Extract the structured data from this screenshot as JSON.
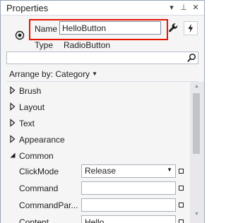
{
  "window": {
    "title": "Properties"
  },
  "titlebar": {
    "dropdown_glyph": "▾",
    "pin_glyph": "⊥",
    "close_glyph": "✕"
  },
  "selection": {
    "name_label": "Name",
    "name_value": "HelloButton",
    "type_label": "Type",
    "type_value": "RadioButton"
  },
  "search": {
    "value": ""
  },
  "arrange": {
    "label": "Arrange by: Category"
  },
  "categories": [
    {
      "label": "Brush",
      "expanded": false
    },
    {
      "label": "Layout",
      "expanded": false
    },
    {
      "label": "Text",
      "expanded": false
    },
    {
      "label": "Appearance",
      "expanded": false
    },
    {
      "label": "Common",
      "expanded": true
    }
  ],
  "properties": [
    {
      "label": "ClickMode",
      "value": "Release",
      "has_dropdown": true
    },
    {
      "label": "Command",
      "value": ""
    },
    {
      "label": "CommandPar...",
      "value": ""
    },
    {
      "label": "Content",
      "value": "Hello"
    }
  ],
  "colors": {
    "highlight": "#e51400",
    "accent": "#1e1e1e"
  },
  "icons": {
    "radio": "radio-button-icon",
    "wrench": "wrench-icon",
    "events": "lightning-icon",
    "search": "search-icon"
  }
}
